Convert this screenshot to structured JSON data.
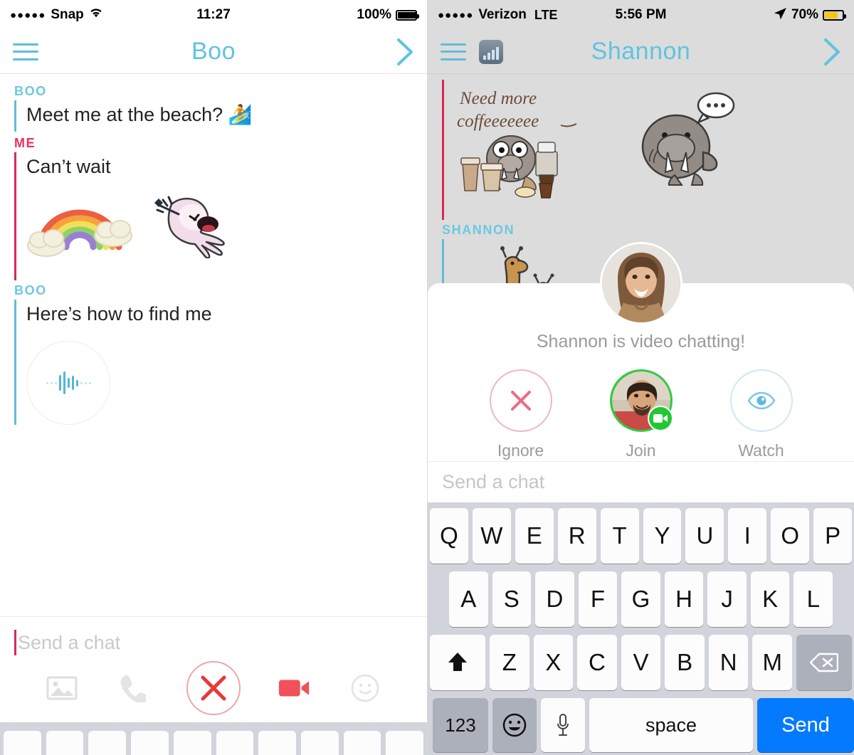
{
  "left_phone": {
    "status_bar": {
      "signal_dots": "●●●●●",
      "carrier": "Snap",
      "wifi_icon": "wifi-icon",
      "time": "11:27",
      "battery_percent": "100%",
      "battery_level": 100
    },
    "nav": {
      "menu_icon": "hamburger-menu-icon",
      "title": "Boo",
      "forward_icon": "chevron-right-icon"
    },
    "messages": [
      {
        "sender": "BOO",
        "accent": "blue",
        "text": "Meet me at the beach? 🏄",
        "type": "text"
      },
      {
        "sender": "ME",
        "accent": "pink",
        "text": "Can’t wait",
        "type": "text",
        "stickers": [
          "rainbow-sticker",
          "ghost-sticker"
        ]
      },
      {
        "sender": "BOO",
        "accent": "blue",
        "text": "Here’s how to find me",
        "type": "text",
        "attachment": "voice-note"
      }
    ],
    "selfie": {
      "name": "selfie-thumbnail",
      "ring_color": "#e8392f"
    },
    "composer": {
      "placeholder": "Send a chat",
      "caret_color": "#d82a56",
      "icons": [
        "photo-icon",
        "phone-icon",
        "close-x-icon",
        "video-camera-icon",
        "sticker-smiley-icon"
      ]
    },
    "colors": {
      "accent_blue": "#5fbdd9",
      "label_blue": "#6ec8e0",
      "label_pink": "#ef2e63",
      "bar_pink": "#d82a56",
      "red": "#f2505a"
    }
  },
  "right_phone": {
    "status_bar": {
      "signal_dots": "●●●●●",
      "carrier": "Verizon",
      "network": "LTE",
      "time": "5:56 PM",
      "location_icon": "location-arrow-icon",
      "battery_percent": "70%",
      "battery_level": 70
    },
    "nav": {
      "menu_icon": "hamburger-menu-icon",
      "signal_icon": "signal-bars-icon",
      "title": "Shannon",
      "forward_icon": "chevron-right-icon"
    },
    "messages": [
      {
        "sender": "",
        "accent": "pink",
        "type": "sticker",
        "note_line1": "Need more",
        "note_line2": "coffeeeeeee",
        "stickers": [
          "walrus-coffee-sticker",
          "walrus-speech-bubble-sticker"
        ]
      },
      {
        "sender": "SHANNON",
        "accent": "blue",
        "type": "sticker",
        "stickers": [
          "giraffe-sticker"
        ]
      }
    ],
    "video_chat": {
      "caller_avatar": "shannon-avatar",
      "status_text": "Shannon is video chatting!",
      "actions": [
        {
          "label": "Ignore",
          "icon": "x-close-icon",
          "ring_color": "#eeb8c2"
        },
        {
          "label": "Join",
          "icon": "user-avatar-with-video-badge",
          "ring_color": "#2ecc40"
        },
        {
          "label": "Watch",
          "icon": "eye-icon",
          "ring_color": "#cfe8f3"
        }
      ]
    },
    "composer": {
      "placeholder": "Send a chat"
    },
    "keyboard": {
      "row1": [
        "Q",
        "W",
        "E",
        "R",
        "T",
        "Y",
        "U",
        "I",
        "O",
        "P"
      ],
      "row2": [
        "A",
        "S",
        "D",
        "F",
        "G",
        "H",
        "J",
        "K",
        "L"
      ],
      "row3": [
        "Z",
        "X",
        "C",
        "V",
        "B",
        "N",
        "M"
      ],
      "shift_icon": "shift-arrow-icon",
      "delete_icon": "backspace-icon",
      "numbers_key": "123",
      "emoji_key": "emoji-smiley-icon",
      "mic_key": "microphone-icon",
      "space_key": "space",
      "send_key": "Send",
      "send_color": "#047aff"
    },
    "colors": {
      "dim_overlay": "#dcdcdc",
      "accent_blue": "#5fbdd9",
      "label_blue": "#6ec8e0"
    }
  }
}
